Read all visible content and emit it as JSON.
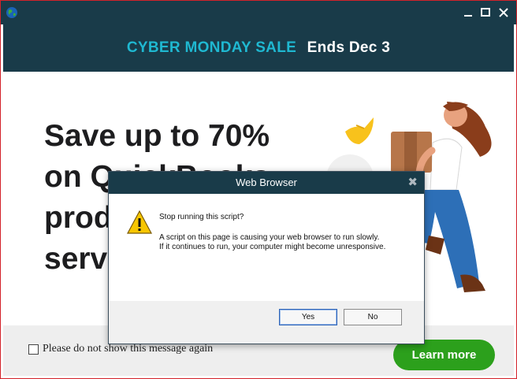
{
  "banner": {
    "sale_text": "CYBER MONDAY SALE",
    "ends_text": "Ends Dec 3"
  },
  "headline": {
    "lines": [
      "Save up to 70%",
      "on QuickBooks",
      "products and",
      "services"
    ]
  },
  "footer": {
    "checkbox_label": "Please do not show this message again",
    "checkbox_checked": false,
    "learn_more_label": "Learn more"
  },
  "dialog": {
    "title": "Web Browser",
    "question": "Stop running this script?",
    "line1": "A script on this page is causing your web browser to run slowly.",
    "line2": "If it continues to run, your computer might become unresponsive.",
    "yes_label": "Yes",
    "no_label": "No"
  },
  "colors": {
    "brand_dark": "#193b49",
    "sale_cyan": "#1fb8d1",
    "green": "#2ca01c",
    "frame_red": "#d3222a",
    "warning_yellow": "#f7c600"
  },
  "icons": [
    "globe-icon",
    "minimize-icon",
    "maximize-icon",
    "close-icon",
    "warning-icon",
    "dialog-close-icon"
  ]
}
